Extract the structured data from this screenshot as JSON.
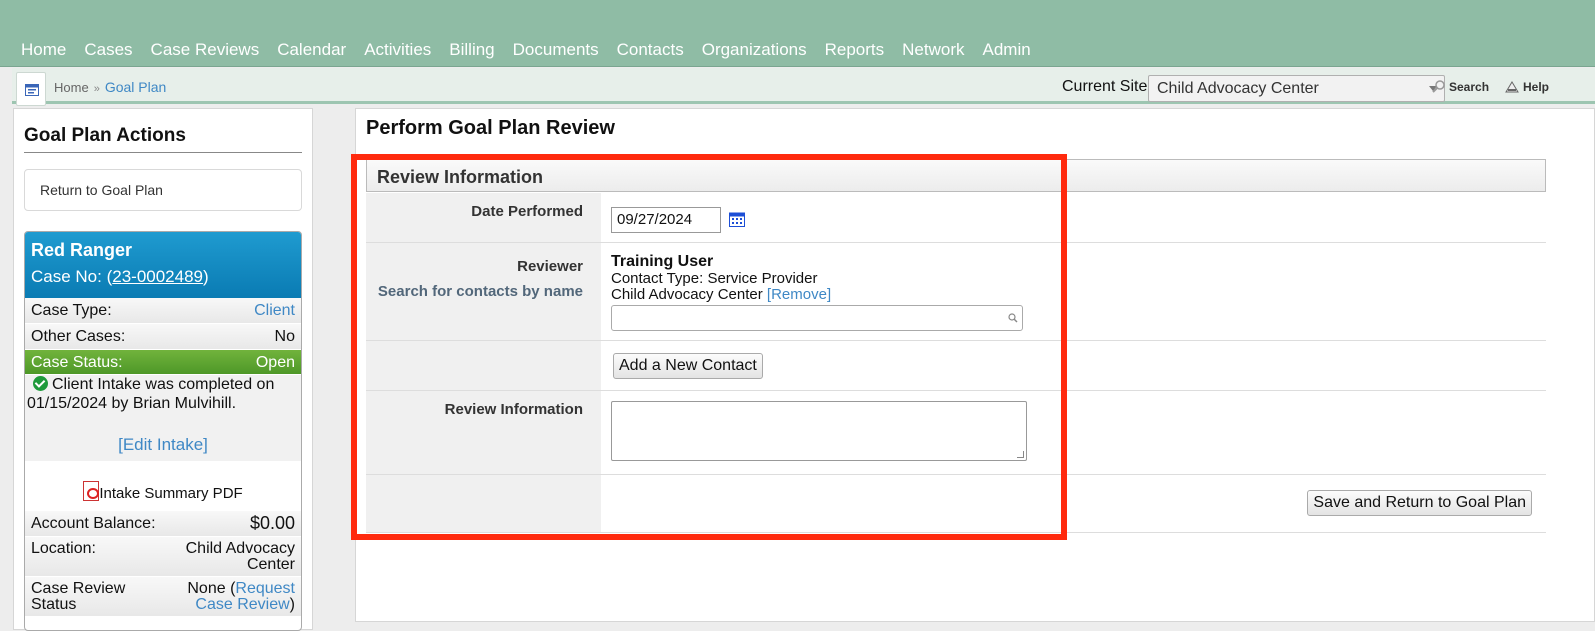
{
  "nav": {
    "items": [
      "Home",
      "Cases",
      "Case Reviews",
      "Calendar",
      "Activities",
      "Billing",
      "Documents",
      "Contacts",
      "Organizations",
      "Reports",
      "Network",
      "Admin"
    ]
  },
  "breadcrumb": {
    "home": "Home",
    "separator": "»",
    "current": "Goal Plan"
  },
  "site": {
    "label": "Current Site",
    "selected": "Child Advocacy Center"
  },
  "toplinks": {
    "search": "Search",
    "help": "Help"
  },
  "sidebar": {
    "title": "Goal Plan Actions",
    "action": "Return to Goal Plan",
    "case": {
      "name": "Red Ranger",
      "number_prefix": "Case No: (",
      "number": "23-0002489",
      "number_suffix": ")",
      "case_type_label": "Case Type:",
      "case_type_value": "Client",
      "other_cases_label": "Other Cases:",
      "other_cases_value": "No",
      "status_label": "Case Status:",
      "status_value": "Open",
      "intake_text": "Client Intake was completed on 01/15/2024 by Brian Mulvihill.",
      "edit_intake": "[Edit Intake]",
      "pdf_label": "Intake Summary PDF",
      "balance_label": "Account Balance:",
      "balance_value": "$0.00",
      "location_label": "Location:",
      "location_value_1": "Child Advocacy",
      "location_value_2": "Center",
      "review_label_1": "Case Review",
      "review_label_2": "Status",
      "review_value_prefix": "None (",
      "review_link_1": "Request",
      "review_link_2": "Case Review",
      "review_value_suffix": ")"
    }
  },
  "main": {
    "title": "Perform Goal Plan Review",
    "section": "Review Information",
    "date_label": "Date Performed",
    "date_value": "09/27/2024",
    "reviewer_label": "Reviewer",
    "reviewer_sublabel": "Search for contacts by name",
    "reviewer_name": "Training User",
    "reviewer_type": "Contact Type: Service Provider",
    "reviewer_org": "Child Advocacy Center",
    "remove_link": "[Remove]",
    "add_contact": "Add a New Contact",
    "review_info_label": "Review Information",
    "review_info_value": "",
    "save_button": "Save and Return to Goal Plan"
  },
  "colors": {
    "nav_bg": "#8fbca5",
    "link": "#3f88c5",
    "case_header": "#0a7bb3",
    "status_green": "#4e9828",
    "highlight": "#ff2a0e"
  }
}
